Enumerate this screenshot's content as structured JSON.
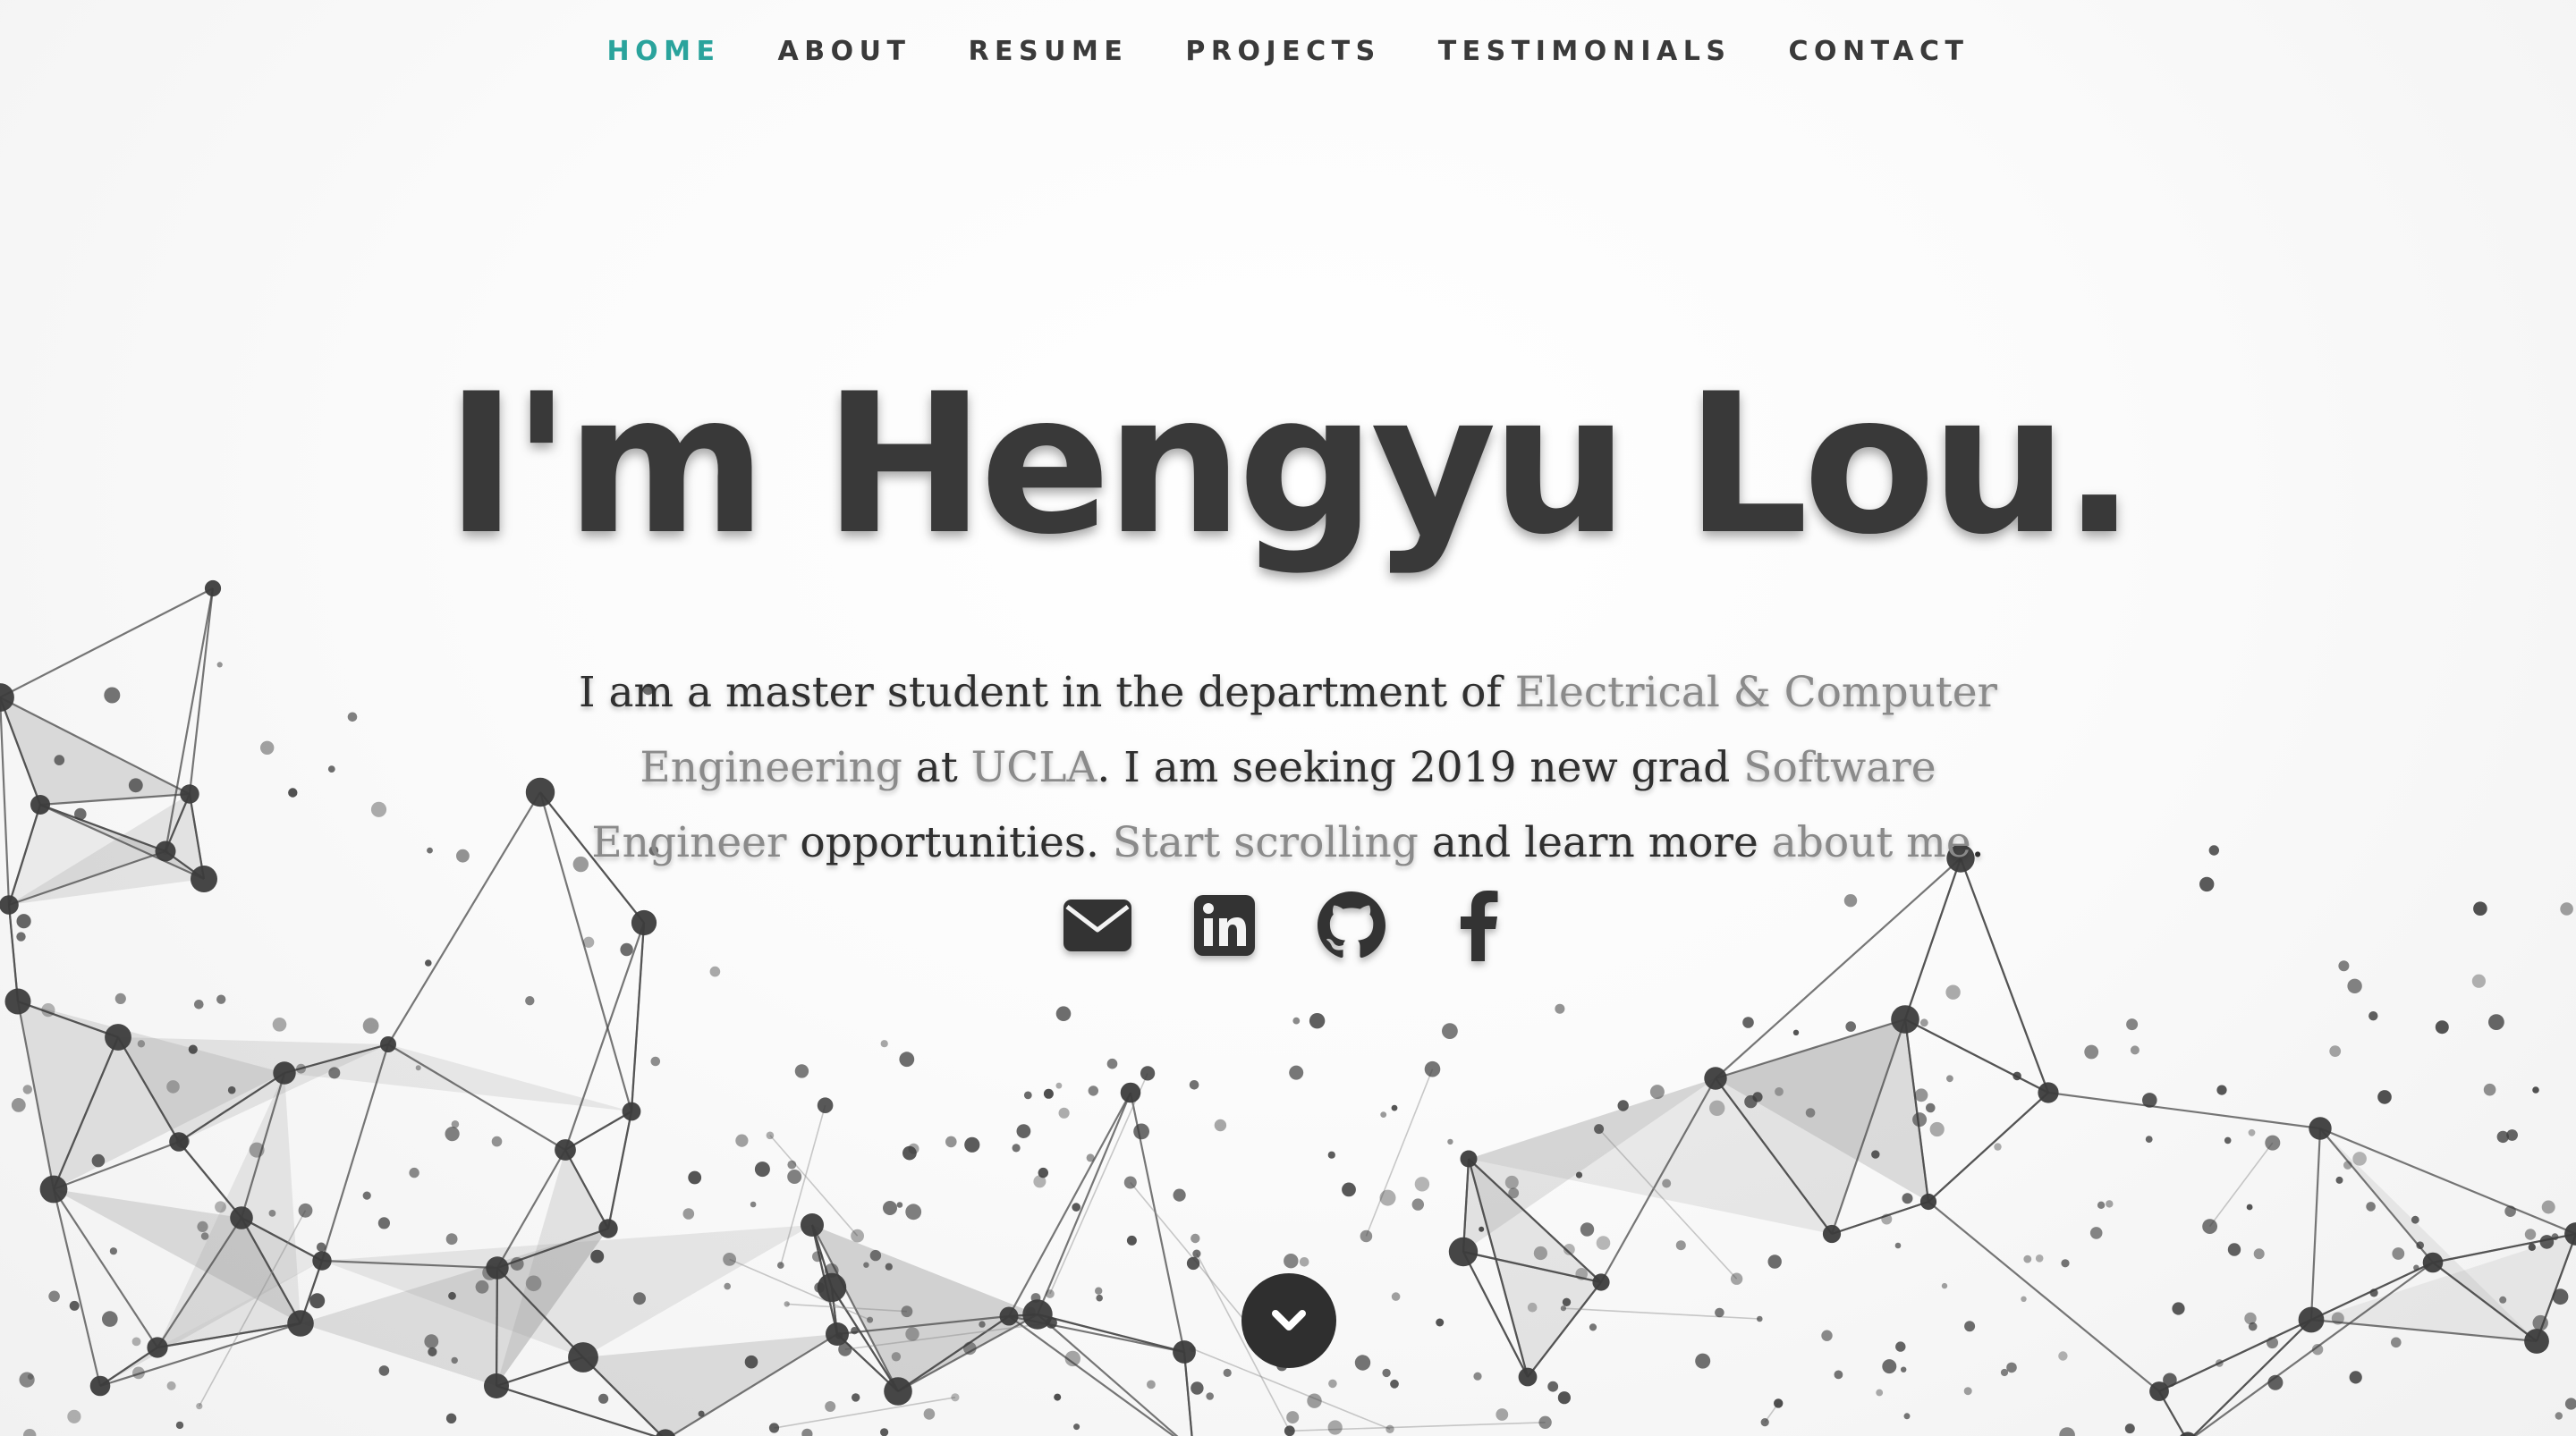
{
  "nav": {
    "items": [
      {
        "label": "HOME",
        "active": true
      },
      {
        "label": "ABOUT",
        "active": false
      },
      {
        "label": "RESUME",
        "active": false
      },
      {
        "label": "PROJECTS",
        "active": false
      },
      {
        "label": "TESTIMONIALS",
        "active": false
      },
      {
        "label": "CONTACT",
        "active": false
      }
    ],
    "active_color": "#2aa39c"
  },
  "hero": {
    "headline": "I'm Hengyu Lou.",
    "intro": {
      "t1": "I am a master student in the department of ",
      "l1": "Electrical & Computer Engineering",
      "t2": " at ",
      "l2": "UCLA",
      "t3": ". I am seeking 2019 new grad ",
      "l3": "Software Engineer",
      "t4": " opportunities. ",
      "l4": "Start scrolling",
      "t5": " and learn more ",
      "l5": "about me",
      "t6": "."
    }
  },
  "social": [
    "envelope-icon",
    "linkedin-icon",
    "github-icon",
    "facebook-icon"
  ],
  "scroll_button": {
    "icon": "chevron-down-icon"
  },
  "colors": {
    "text": "#3a3a3a",
    "link": "#8a8a8a",
    "accent": "#2aa39c",
    "network": "#3c3c3c"
  }
}
